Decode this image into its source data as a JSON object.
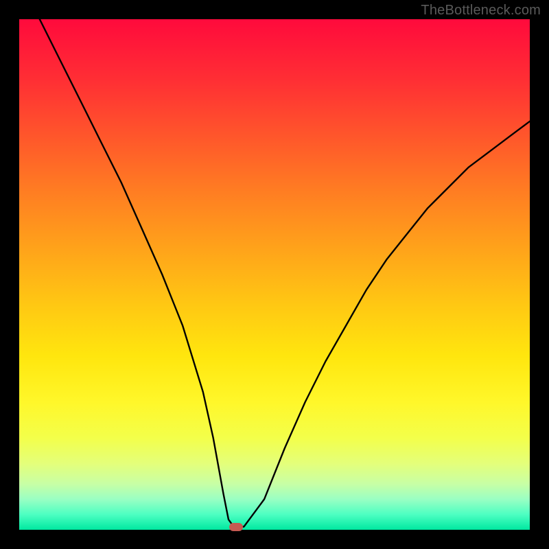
{
  "watermark": {
    "text": "TheBottleneck.com"
  },
  "chart_data": {
    "type": "line",
    "title": "",
    "xlabel": "",
    "ylabel": "",
    "xlim": [
      0,
      100
    ],
    "ylim": [
      0,
      100
    ],
    "grid": false,
    "legend": false,
    "series": [
      {
        "name": "curve",
        "x": [
          4,
          8,
          12,
          16,
          20,
          24,
          28,
          32,
          36,
          38,
          40,
          41,
          42,
          43,
          44,
          48,
          52,
          56,
          60,
          64,
          68,
          72,
          76,
          80,
          84,
          88,
          92,
          96,
          100
        ],
        "y": [
          100,
          92,
          84,
          76,
          68,
          59,
          50,
          40,
          27,
          18,
          7,
          2,
          0.6,
          0.6,
          0.6,
          6,
          16,
          25,
          33,
          40,
          47,
          53,
          58,
          63,
          67,
          71,
          74,
          77,
          80
        ]
      }
    ],
    "marker": {
      "x": 42.5,
      "y": 0.6,
      "color": "#c65a52"
    },
    "line_color": "#000000",
    "line_width": 2.4,
    "background": "rainbow-gradient-vertical"
  }
}
